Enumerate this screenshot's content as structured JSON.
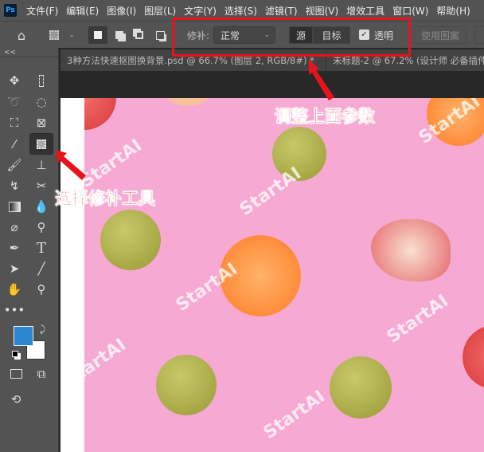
{
  "menubar": {
    "logo": "Ps",
    "items": [
      "文件(F)",
      "编辑(E)",
      "图像(I)",
      "图层(L)",
      "文字(Y)",
      "选择(S)",
      "滤镜(T)",
      "视图(V)",
      "增效工具",
      "窗口(W)",
      "帮助(H)"
    ]
  },
  "options": {
    "patch_label": "修补:",
    "patch_mode": "正常",
    "source_label": "源",
    "target_label": "目标",
    "transparent_label": "透明",
    "transparent_checked": true,
    "use_pattern_label": "使用图案"
  },
  "tabs": [
    {
      "title": "3种方法快速抠图换背景.psd @ 66.7% (图层 2, RGB/8#) *"
    },
    {
      "title": "未标题-2 @ 67.2% (设计师 必备插件"
    }
  ],
  "toolbar": {
    "collapse": "<<",
    "foreground_color": "#2a86d1",
    "background_color": "#ffffff"
  },
  "annotations": {
    "top": "调整上面参数",
    "left": "选择修补工具"
  },
  "watermark": "StartAI",
  "colors": {
    "accent": "#e8141b",
    "canvas_bg": "#f6a9d3"
  }
}
